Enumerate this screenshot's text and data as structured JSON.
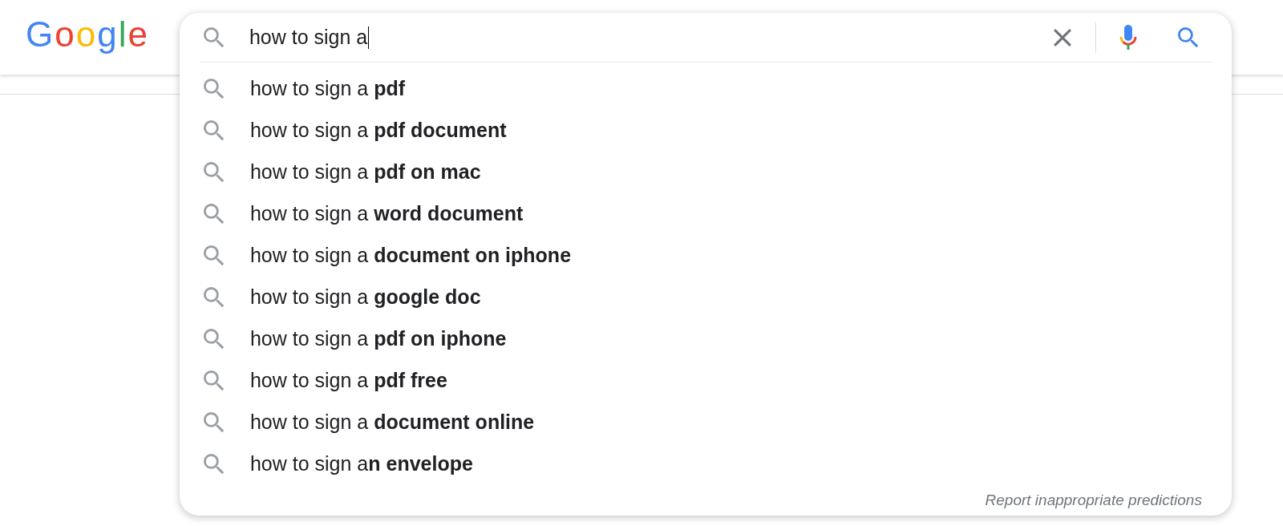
{
  "header": {
    "logo": "Google"
  },
  "search": {
    "value": "how to sign a",
    "focused": true
  },
  "suggestions": [
    "how to sign a **pdf**",
    "how to sign a **pdf document**",
    "how to sign a **pdf on mac**",
    "how to sign a **word document**",
    "how to sign a **document on iphone**",
    "how to sign a **google doc**",
    "how to sign a **pdf on iphone**",
    "how to sign a **pdf free**",
    "how to sign a **document online**",
    "how to sign a**n envelope**"
  ],
  "report_link": "Report inappropriate predictions"
}
